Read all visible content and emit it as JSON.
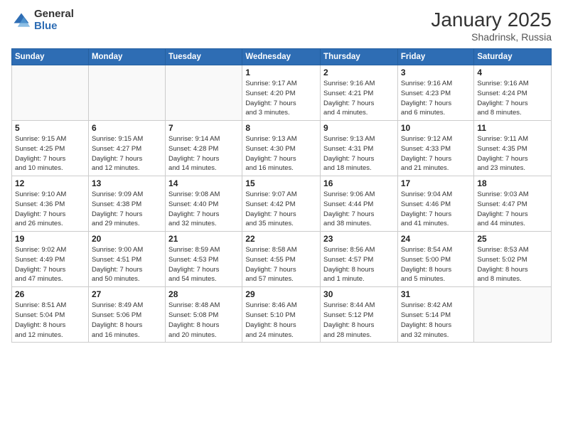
{
  "logo": {
    "general": "General",
    "blue": "Blue"
  },
  "title": "January 2025",
  "subtitle": "Shadrinsk, Russia",
  "days_of_week": [
    "Sunday",
    "Monday",
    "Tuesday",
    "Wednesday",
    "Thursday",
    "Friday",
    "Saturday"
  ],
  "weeks": [
    [
      {
        "day": "",
        "info": ""
      },
      {
        "day": "",
        "info": ""
      },
      {
        "day": "",
        "info": ""
      },
      {
        "day": "1",
        "info": "Sunrise: 9:17 AM\nSunset: 4:20 PM\nDaylight: 7 hours\nand 3 minutes."
      },
      {
        "day": "2",
        "info": "Sunrise: 9:16 AM\nSunset: 4:21 PM\nDaylight: 7 hours\nand 4 minutes."
      },
      {
        "day": "3",
        "info": "Sunrise: 9:16 AM\nSunset: 4:23 PM\nDaylight: 7 hours\nand 6 minutes."
      },
      {
        "day": "4",
        "info": "Sunrise: 9:16 AM\nSunset: 4:24 PM\nDaylight: 7 hours\nand 8 minutes."
      }
    ],
    [
      {
        "day": "5",
        "info": "Sunrise: 9:15 AM\nSunset: 4:25 PM\nDaylight: 7 hours\nand 10 minutes."
      },
      {
        "day": "6",
        "info": "Sunrise: 9:15 AM\nSunset: 4:27 PM\nDaylight: 7 hours\nand 12 minutes."
      },
      {
        "day": "7",
        "info": "Sunrise: 9:14 AM\nSunset: 4:28 PM\nDaylight: 7 hours\nand 14 minutes."
      },
      {
        "day": "8",
        "info": "Sunrise: 9:13 AM\nSunset: 4:30 PM\nDaylight: 7 hours\nand 16 minutes."
      },
      {
        "day": "9",
        "info": "Sunrise: 9:13 AM\nSunset: 4:31 PM\nDaylight: 7 hours\nand 18 minutes."
      },
      {
        "day": "10",
        "info": "Sunrise: 9:12 AM\nSunset: 4:33 PM\nDaylight: 7 hours\nand 21 minutes."
      },
      {
        "day": "11",
        "info": "Sunrise: 9:11 AM\nSunset: 4:35 PM\nDaylight: 7 hours\nand 23 minutes."
      }
    ],
    [
      {
        "day": "12",
        "info": "Sunrise: 9:10 AM\nSunset: 4:36 PM\nDaylight: 7 hours\nand 26 minutes."
      },
      {
        "day": "13",
        "info": "Sunrise: 9:09 AM\nSunset: 4:38 PM\nDaylight: 7 hours\nand 29 minutes."
      },
      {
        "day": "14",
        "info": "Sunrise: 9:08 AM\nSunset: 4:40 PM\nDaylight: 7 hours\nand 32 minutes."
      },
      {
        "day": "15",
        "info": "Sunrise: 9:07 AM\nSunset: 4:42 PM\nDaylight: 7 hours\nand 35 minutes."
      },
      {
        "day": "16",
        "info": "Sunrise: 9:06 AM\nSunset: 4:44 PM\nDaylight: 7 hours\nand 38 minutes."
      },
      {
        "day": "17",
        "info": "Sunrise: 9:04 AM\nSunset: 4:46 PM\nDaylight: 7 hours\nand 41 minutes."
      },
      {
        "day": "18",
        "info": "Sunrise: 9:03 AM\nSunset: 4:47 PM\nDaylight: 7 hours\nand 44 minutes."
      }
    ],
    [
      {
        "day": "19",
        "info": "Sunrise: 9:02 AM\nSunset: 4:49 PM\nDaylight: 7 hours\nand 47 minutes."
      },
      {
        "day": "20",
        "info": "Sunrise: 9:00 AM\nSunset: 4:51 PM\nDaylight: 7 hours\nand 50 minutes."
      },
      {
        "day": "21",
        "info": "Sunrise: 8:59 AM\nSunset: 4:53 PM\nDaylight: 7 hours\nand 54 minutes."
      },
      {
        "day": "22",
        "info": "Sunrise: 8:58 AM\nSunset: 4:55 PM\nDaylight: 7 hours\nand 57 minutes."
      },
      {
        "day": "23",
        "info": "Sunrise: 8:56 AM\nSunset: 4:57 PM\nDaylight: 8 hours\nand 1 minute."
      },
      {
        "day": "24",
        "info": "Sunrise: 8:54 AM\nSunset: 5:00 PM\nDaylight: 8 hours\nand 5 minutes."
      },
      {
        "day": "25",
        "info": "Sunrise: 8:53 AM\nSunset: 5:02 PM\nDaylight: 8 hours\nand 8 minutes."
      }
    ],
    [
      {
        "day": "26",
        "info": "Sunrise: 8:51 AM\nSunset: 5:04 PM\nDaylight: 8 hours\nand 12 minutes."
      },
      {
        "day": "27",
        "info": "Sunrise: 8:49 AM\nSunset: 5:06 PM\nDaylight: 8 hours\nand 16 minutes."
      },
      {
        "day": "28",
        "info": "Sunrise: 8:48 AM\nSunset: 5:08 PM\nDaylight: 8 hours\nand 20 minutes."
      },
      {
        "day": "29",
        "info": "Sunrise: 8:46 AM\nSunset: 5:10 PM\nDaylight: 8 hours\nand 24 minutes."
      },
      {
        "day": "30",
        "info": "Sunrise: 8:44 AM\nSunset: 5:12 PM\nDaylight: 8 hours\nand 28 minutes."
      },
      {
        "day": "31",
        "info": "Sunrise: 8:42 AM\nSunset: 5:14 PM\nDaylight: 8 hours\nand 32 minutes."
      },
      {
        "day": "",
        "info": ""
      }
    ]
  ]
}
